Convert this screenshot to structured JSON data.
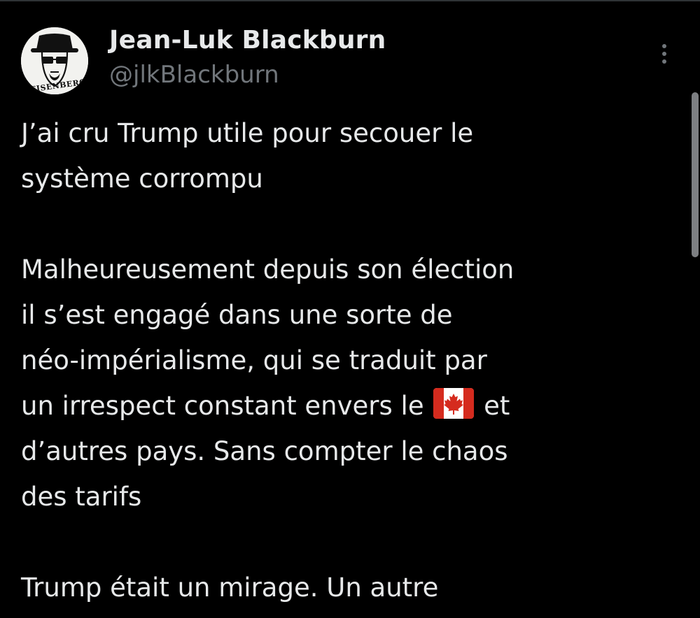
{
  "tweet": {
    "author": {
      "display_name": "Jean-Luk Blackburn",
      "handle": "@jlkBlackburn",
      "avatar_label": "HEISENBERG"
    },
    "more_icon": "more-vertical-icon",
    "body": [
      {
        "text": "J’ai cru Trump utile pour secouer le"
      },
      {
        "text": "système corrompu"
      },
      {
        "blank": true
      },
      {
        "text": "Malheureusement depuis son élection"
      },
      {
        "text": "il s’est engagé dans une sorte de"
      },
      {
        "text": "néo-impérialisme, qui se traduit par"
      },
      {
        "before": "un irrespect constant envers le",
        "emoji": "canada-flag",
        "after": "et"
      },
      {
        "text": "d’autres pays. Sans compter le chaos"
      },
      {
        "text": "des tarifs"
      },
      {
        "blank": true
      },
      {
        "text": "Trump était un mirage. Un autre"
      }
    ]
  },
  "colors": {
    "background": "#000000",
    "primary_text": "#e7e9ea",
    "secondary_text": "#71767b",
    "flag_red": "#d52b1e",
    "scrollbar": "#7d7f82"
  }
}
